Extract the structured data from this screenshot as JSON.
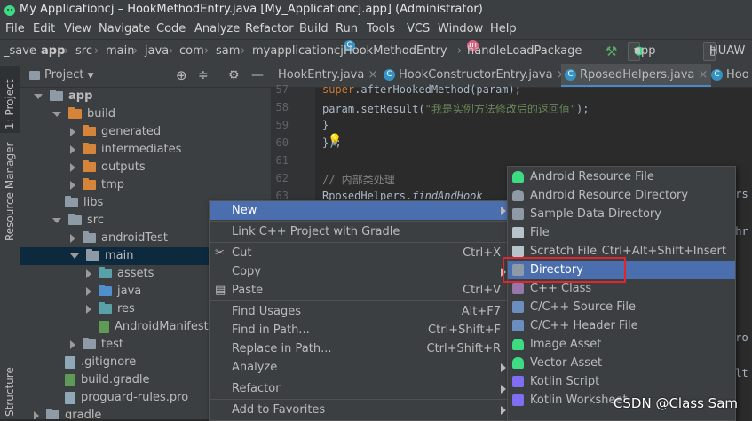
{
  "window": {
    "title": "My Applicationcj – HookMethodEntry.java [My_Applicationcj.app] (Administrator)"
  },
  "menubar": [
    "File",
    "Edit",
    "View",
    "Navigate",
    "Code",
    "Analyze",
    "Refactor",
    "Build",
    "Run",
    "Tools",
    "VCS",
    "Window",
    "Help"
  ],
  "breadcrumb": {
    "items": [
      "_save",
      "app",
      "src",
      "main",
      "java",
      "com",
      "sam",
      "myapplicationcj",
      "HookMethodEntry",
      "handleLoadPackage"
    ],
    "run_config": "app",
    "device": "HUAW"
  },
  "left_strip": {
    "project_tab": "1: Project",
    "resource_manager_tab": "Resource Manager",
    "structure_tab": "Structure"
  },
  "project_panel": {
    "header": "Project",
    "tree": [
      {
        "label": "app",
        "indent": 0,
        "arrow": "down",
        "icon": "module"
      },
      {
        "label": "build",
        "indent": 1,
        "arrow": "down",
        "icon": "folder-orange"
      },
      {
        "label": "generated",
        "indent": 2,
        "arrow": "right",
        "icon": "folder-orange"
      },
      {
        "label": "intermediates",
        "indent": 2,
        "arrow": "right",
        "icon": "folder-orange"
      },
      {
        "label": "outputs",
        "indent": 2,
        "arrow": "right",
        "icon": "folder-orange"
      },
      {
        "label": "tmp",
        "indent": 2,
        "arrow": "right",
        "icon": "folder-orange"
      },
      {
        "label": "libs",
        "indent": 1,
        "arrow": "none",
        "icon": "folder-gray"
      },
      {
        "label": "src",
        "indent": 1,
        "arrow": "down",
        "icon": "folder-gray"
      },
      {
        "label": "androidTest",
        "indent": 2,
        "arrow": "right",
        "icon": "folder-gray"
      },
      {
        "label": "main",
        "indent": 2,
        "arrow": "down",
        "icon": "folder-gray"
      },
      {
        "label": "assets",
        "indent": 3,
        "arrow": "right",
        "icon": "folder-teal"
      },
      {
        "label": "java",
        "indent": 3,
        "arrow": "right",
        "icon": "folder-blue"
      },
      {
        "label": "res",
        "indent": 3,
        "arrow": "right",
        "icon": "folder-teal"
      },
      {
        "label": "AndroidManifest.x",
        "indent": 3,
        "arrow": "none",
        "icon": "file-manifest"
      },
      {
        "label": "test",
        "indent": 2,
        "arrow": "right",
        "icon": "folder-gray"
      },
      {
        "label": ".gitignore",
        "indent": 1,
        "arrow": "none",
        "icon": "file"
      },
      {
        "label": "build.gradle",
        "indent": 1,
        "arrow": "none",
        "icon": "file-gradle"
      },
      {
        "label": "proguard-rules.pro",
        "indent": 1,
        "arrow": "none",
        "icon": "file"
      },
      {
        "label": "gradle",
        "indent": 0,
        "arrow": "right",
        "icon": "folder-gray"
      }
    ]
  },
  "tabs": [
    "HookEntry.java",
    "HookConstructorEntry.java",
    "RposedHelpers.java",
    "Hoo"
  ],
  "editor": {
    "lines": [
      {
        "n": "57",
        "segments": [
          {
            "t": "            ",
            "c": ""
          },
          {
            "t": "super",
            "c": "kw"
          },
          {
            "t": ".afterHookedMethod(param);",
            "c": ""
          }
        ]
      },
      {
        "n": "58",
        "segments": [
          {
            "t": "            param.setResult(",
            "c": ""
          },
          {
            "t": "\"我是实例方法修改后的返回值\"",
            "c": "str"
          },
          {
            "t": ");",
            "c": ""
          }
        ]
      },
      {
        "n": "59",
        "segments": [
          {
            "t": "        }",
            "c": ""
          }
        ]
      },
      {
        "n": "60",
        "segments": [
          {
            "t": "    });",
            "c": ""
          }
        ]
      },
      {
        "n": "61",
        "segments": []
      },
      {
        "n": "62",
        "segments": [
          {
            "t": "    ",
            "c": ""
          },
          {
            "t": "// 内部类处理",
            "c": "cm"
          }
        ]
      },
      {
        "n": "63",
        "segments": [
          {
            "t": "    RposedHelpers.",
            "c": ""
          },
          {
            "t": "findAndHook",
            "c": "it"
          }
        ]
      }
    ]
  },
  "context_menu": {
    "items": [
      {
        "label": "New",
        "shortcut": "",
        "submenu": true,
        "icon": "",
        "highlight": true
      },
      {
        "sep": true
      },
      {
        "label": "Link C++ Project with Gradle",
        "shortcut": "",
        "submenu": false,
        "icon": ""
      },
      {
        "sep": true
      },
      {
        "label": "Cut",
        "shortcut": "Ctrl+X",
        "submenu": false,
        "icon": "scissors-icon"
      },
      {
        "label": "Copy",
        "shortcut": "",
        "submenu": true,
        "icon": ""
      },
      {
        "label": "Paste",
        "shortcut": "Ctrl+V",
        "submenu": false,
        "icon": "clipboard-icon"
      },
      {
        "sep": true
      },
      {
        "label": "Find Usages",
        "shortcut": "Alt+F7",
        "submenu": false,
        "icon": ""
      },
      {
        "label": "Find in Path...",
        "shortcut": "Ctrl+Shift+F",
        "submenu": false,
        "icon": ""
      },
      {
        "label": "Replace in Path...",
        "shortcut": "Ctrl+Shift+R",
        "submenu": false,
        "icon": ""
      },
      {
        "label": "Analyze",
        "shortcut": "",
        "submenu": true,
        "icon": ""
      },
      {
        "sep": true
      },
      {
        "label": "Refactor",
        "shortcut": "",
        "submenu": true,
        "icon": ""
      },
      {
        "sep": true
      },
      {
        "label": "Add to Favorites",
        "shortcut": "",
        "submenu": true,
        "icon": ""
      }
    ]
  },
  "new_submenu": {
    "items": [
      {
        "label": "Android Resource File",
        "shortcut": "",
        "icon": "android-file-icon"
      },
      {
        "label": "Android Resource Directory",
        "shortcut": "",
        "icon": "android-folder-icon"
      },
      {
        "label": "Sample Data Directory",
        "shortcut": "",
        "icon": "folder-icon"
      },
      {
        "label": "File",
        "shortcut": "",
        "icon": "file-icon"
      },
      {
        "label": "Scratch File",
        "shortcut": "Ctrl+Alt+Shift+Insert",
        "icon": "scratch-icon"
      },
      {
        "label": "Directory",
        "shortcut": "",
        "icon": "folder-icon",
        "highlight": true
      },
      {
        "label": "C++ Class",
        "shortcut": "",
        "icon": "cpp-class-icon"
      },
      {
        "label": "C/C++ Source File",
        "shortcut": "",
        "icon": "cpp-source-icon"
      },
      {
        "label": "C/C++ Header File",
        "shortcut": "",
        "icon": "cpp-header-icon"
      },
      {
        "label": "Image Asset",
        "shortcut": "",
        "icon": "android-icon"
      },
      {
        "label": "Vector Asset",
        "shortcut": "",
        "icon": "android-icon"
      },
      {
        "label": "Kotlin Script",
        "shortcut": "",
        "icon": "kotlin-icon"
      },
      {
        "label": "Kotlin Worksheet",
        "shortcut": "",
        "icon": "kotlin-icon"
      }
    ]
  },
  "right_edge_fragments": [
    "urs",
    "thr",
    "p",
    "hro",
    "ult"
  ],
  "watermark": "CSDN @Class Sam",
  "colors": {
    "accent": "#4b6eaf",
    "highlight_box": "#e0262b"
  }
}
